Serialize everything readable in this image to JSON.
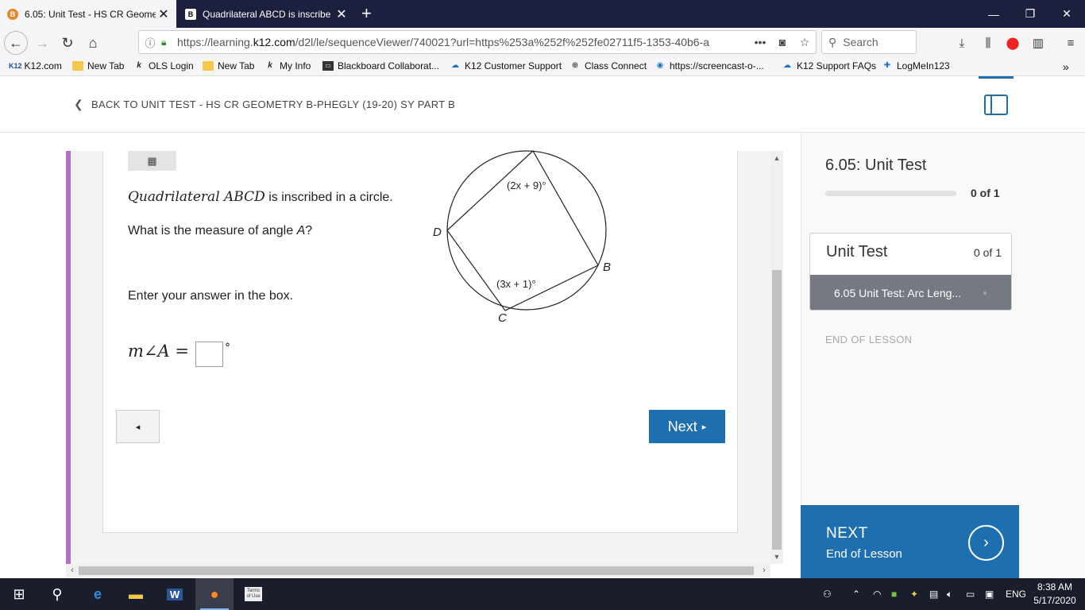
{
  "browser": {
    "tabs": [
      {
        "title": "6.05: Unit Test - HS CR Geomet",
        "favicon": "B"
      },
      {
        "title": "Quadrilateral ABCD  is inscribe",
        "favicon": "B"
      }
    ],
    "url_prefix": "https://learning.",
    "url_domain": "k12.com",
    "url_rest": "/d2l/le/sequenceViewer/740021?url=https%253a%252f%252fe02711f5-1353-40b6-a",
    "search_placeholder": "Search",
    "bookmarks": [
      {
        "label": "K12.com",
        "icon": "k12-logo"
      },
      {
        "label": "New Tab",
        "icon": "folder"
      },
      {
        "label": "OLS Login",
        "icon": "k12"
      },
      {
        "label": "New Tab",
        "icon": "folder"
      },
      {
        "label": "My Info",
        "icon": "k12"
      },
      {
        "label": "Blackboard Collaborat...",
        "icon": "blackboard"
      },
      {
        "label": "K12 Customer Support",
        "icon": "cloud"
      },
      {
        "label": "Class Connect",
        "icon": "globe"
      },
      {
        "label": "https://screencast-o-...",
        "icon": "circle"
      },
      {
        "label": "K12 Support FAQs",
        "icon": "cloud"
      },
      {
        "label": "LogMeIn123",
        "icon": "plus"
      }
    ]
  },
  "page": {
    "back_label": "BACK TO UNIT TEST - HS CR GEOMETRY B-PHEGLY (19-20) SY PART B",
    "question": {
      "line1_math": "Quadrilateral ABCD",
      "line1_text": " is inscribed in a circle.",
      "line2_pre": "What is the measure of angle ",
      "line2_var": "A",
      "line2_post": "?",
      "enter": "Enter your answer in the box.",
      "answer_label": "m∠A =",
      "degree": "°"
    },
    "diagram": {
      "angle_top": "(2x + 9)°",
      "angle_bottom": "(3x + 1)°",
      "label_D": "D",
      "label_B": "B",
      "label_C": "C"
    },
    "prev_label": "◂",
    "next_label": "Next",
    "next_arrow": "▸"
  },
  "sidebar": {
    "title": "6.05: Unit Test",
    "progress_text": "0 of 1",
    "progress_fraction": 0,
    "box_title": "Unit Test",
    "box_count": "0 of 1",
    "box_item": "6.05 Unit Test: Arc Leng...",
    "end_label": "END OF LESSON",
    "next_title": "NEXT",
    "next_sub": "End of Lesson"
  },
  "taskbar": {
    "time": "8:38 AM",
    "date": "5/17/2020",
    "lang": "ENG"
  },
  "colors": {
    "accent": "#1e6fb0",
    "purple": "#b26dc9",
    "tabbar": "#1d1f3e"
  }
}
